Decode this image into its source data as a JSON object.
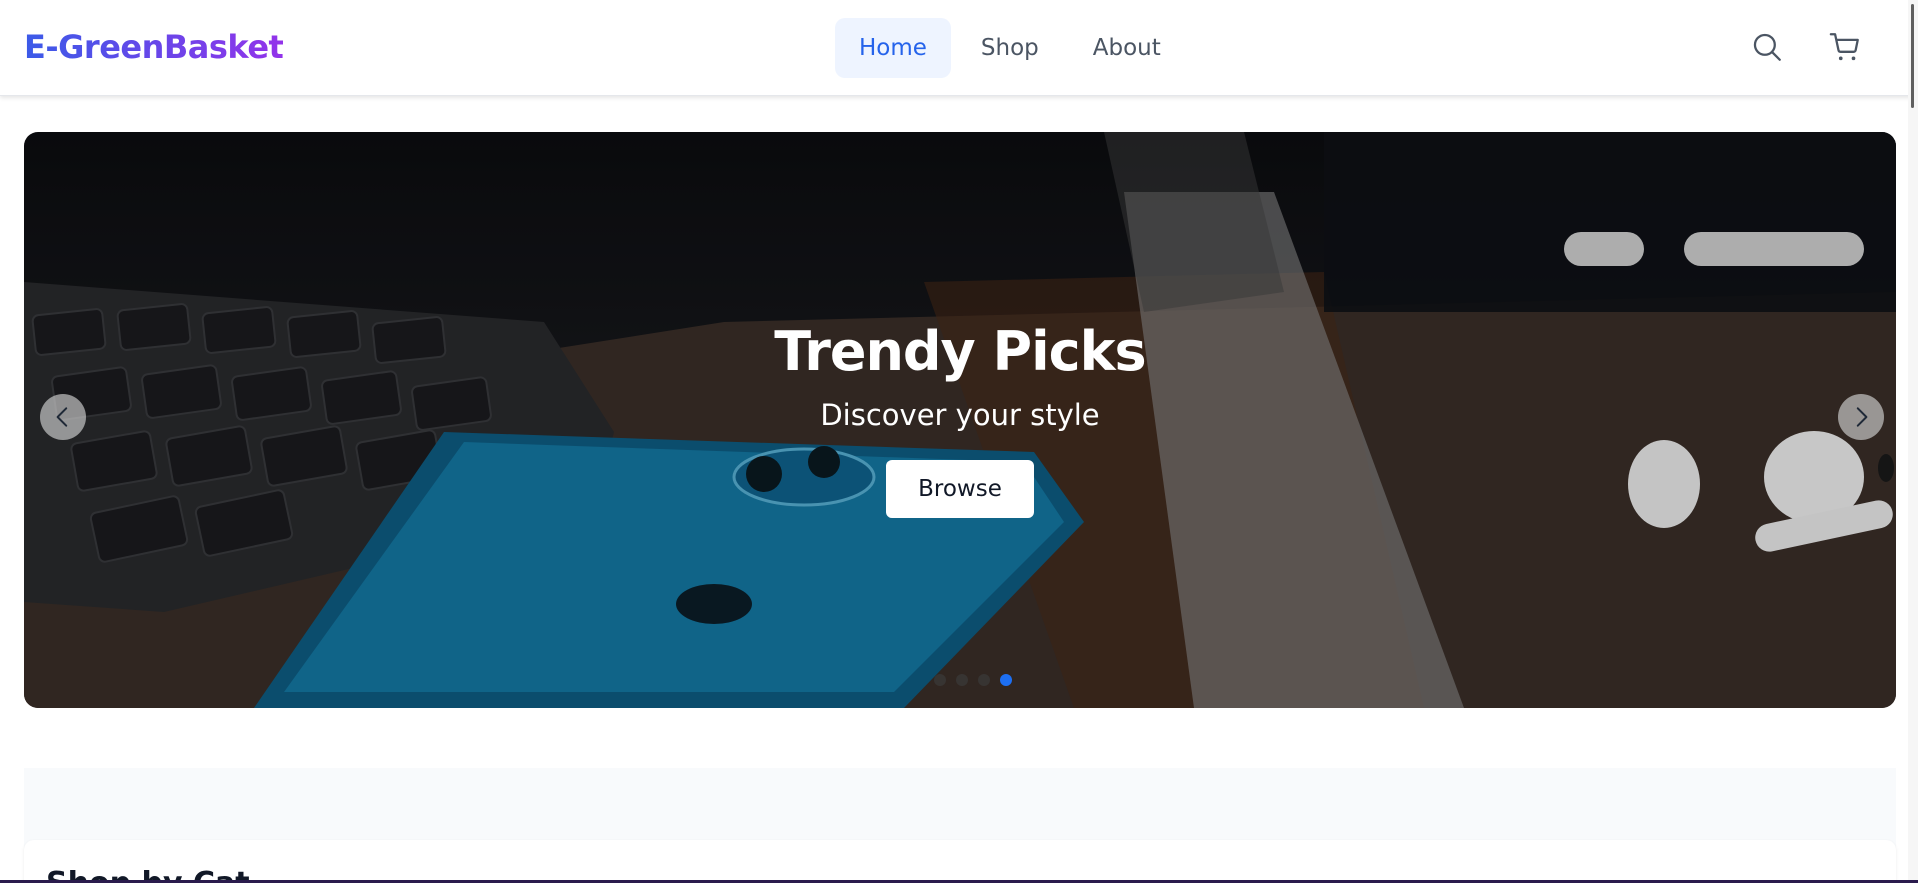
{
  "app": {
    "logo": "E-GreenBasket",
    "logo_gradient": [
      "#3b5be8",
      "#9333ea"
    ]
  },
  "nav": {
    "items": [
      {
        "label": "Home",
        "active": true
      },
      {
        "label": "Shop",
        "active": false
      },
      {
        "label": "About",
        "active": false
      }
    ]
  },
  "header_icons": {
    "search": "search-icon",
    "cart": "cart-icon"
  },
  "hero": {
    "title": "Trendy Picks",
    "subtitle": "Discover your style",
    "button_label": "Browse",
    "slides_total": 4,
    "active_slide": 4,
    "prev_icon": "chevron-left-icon",
    "next_icon": "chevron-right-icon",
    "accent": "#1d6ff2"
  },
  "section": {
    "title": "Shop by Cat"
  }
}
